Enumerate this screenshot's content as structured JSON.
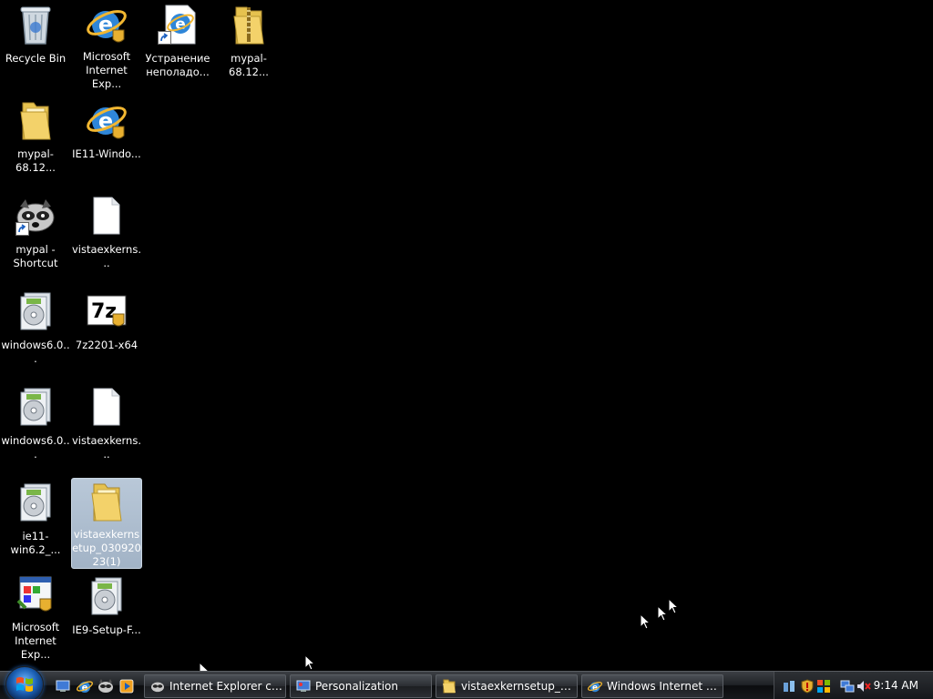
{
  "desktop": {
    "icons": [
      {
        "label": "Recycle Bin",
        "icon": "recycle-bin-icon"
      },
      {
        "label": "Microsoft Internet Exp...",
        "icon": "internet-explorer-icon"
      },
      {
        "label": "Устранение неполадо...",
        "icon": "ie-document-icon"
      },
      {
        "label": "mypal-68.12...",
        "icon": "zip-folder-icon"
      },
      {
        "label": "mypal-68.12...",
        "icon": "folder-icon"
      },
      {
        "label": "IE11-Windo...",
        "icon": "internet-explorer-icon"
      },
      {
        "label": "mypal - Shortcut",
        "icon": "raccoon-icon"
      },
      {
        "label": "vistaexkerns...",
        "icon": "blank-file-icon"
      },
      {
        "label": "windows6.0...",
        "icon": "installer-package-icon"
      },
      {
        "label": "7z2201-x64",
        "icon": "7zip-icon"
      },
      {
        "label": "windows6.0...",
        "icon": "installer-package-icon"
      },
      {
        "label": "vistaexkerns...",
        "icon": "blank-file-icon"
      },
      {
        "label": "ie11-win6.2_...",
        "icon": "installer-package-icon"
      },
      {
        "label": "vistaexkernsetup_03092023(1)",
        "icon": "folder-icon"
      },
      {
        "label": "Microsoft Internet Exp...",
        "icon": "setup-window-icon"
      },
      {
        "label": "IE9-Setup-F...",
        "icon": "installer-package-icon"
      }
    ]
  },
  "taskbar": {
    "start_label": "Start",
    "quick_launch": [
      {
        "name": "show-desktop",
        "icon": "show-desktop-icon"
      },
      {
        "name": "internet-explorer",
        "icon": "internet-explorer-icon"
      },
      {
        "name": "mypal",
        "icon": "raccoon-icon"
      },
      {
        "name": "media-player",
        "icon": "media-player-icon"
      }
    ],
    "tasks": [
      {
        "label": "Internet Explorer с п...",
        "icon": "raccoon-icon"
      },
      {
        "label": "Personalization",
        "icon": "monitor-icon"
      },
      {
        "label": "vistaexkernsetup_03...",
        "icon": "folder-icon"
      },
      {
        "label": "Windows Internet Ex...",
        "icon": "internet-explorer-icon"
      }
    ],
    "tray": {
      "icons": [
        "network-status-icon",
        "security-shield-icon",
        "windows-flag-icon",
        "network-icon",
        "volume-muted-icon"
      ],
      "clock": "9:14 AM"
    }
  },
  "colors": {
    "desktop_bg": "#000000",
    "selection": "#a9b9cb",
    "taskbar": "#1f2226"
  }
}
